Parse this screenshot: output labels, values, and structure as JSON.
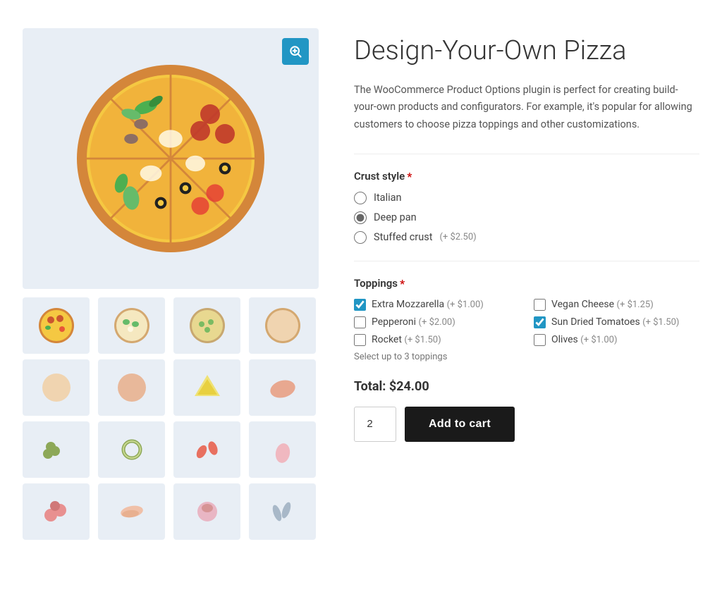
{
  "product": {
    "title": "Design-Your-Own Pizza",
    "description": "The WooCommerce Product Options plugin is perfect for creating build-your-own products and configurators. For example, it's popular for allowing customers to choose pizza toppings and other customizations.",
    "total_label": "Total: $24.00",
    "quantity": "2"
  },
  "zoom_icon": "🔍",
  "crust": {
    "label": "Crust style",
    "required": true,
    "options": [
      {
        "id": "italian",
        "label": "Italian",
        "price": "",
        "checked": false
      },
      {
        "id": "deep_pan",
        "label": "Deep pan",
        "price": "",
        "checked": true
      },
      {
        "id": "stuffed",
        "label": "Stuffed crust",
        "price": "(+ $2.50)",
        "checked": false
      }
    ]
  },
  "toppings": {
    "label": "Toppings",
    "required": true,
    "hint": "Select up to 3 toppings",
    "options": [
      {
        "id": "extra_mozz",
        "label": "Extra Mozzarella",
        "price": "(+ $1.00)",
        "checked": true,
        "col": 1
      },
      {
        "id": "pepperoni",
        "label": "Pepperoni",
        "price": "(+ $2.00)",
        "checked": false,
        "col": 1
      },
      {
        "id": "rocket",
        "label": "Rocket",
        "price": "(+ $1.50)",
        "checked": false,
        "col": 1
      },
      {
        "id": "vegan_cheese",
        "label": "Vegan Cheese",
        "price": "(+ $1.25)",
        "checked": false,
        "col": 2
      },
      {
        "id": "sun_dried",
        "label": "Sun Dried Tomatoes",
        "price": "(+ $1.50)",
        "checked": true,
        "col": 2
      },
      {
        "id": "olives",
        "label": "Olives",
        "price": "(+ $1.00)",
        "checked": false,
        "col": 2
      }
    ]
  },
  "buttons": {
    "add_to_cart": "Add to cart",
    "zoom_label": "Zoom"
  },
  "thumbnails": [
    {
      "color": "#e8a87c",
      "icon": "pizza"
    },
    {
      "color": "#d4e8c2",
      "icon": "pizza-white"
    },
    {
      "color": "#c5ddd4",
      "icon": "pizza-green"
    },
    {
      "color": "#f0d4b0",
      "icon": "plain"
    },
    {
      "color": "#f0d4b0",
      "icon": "plain2"
    },
    {
      "color": "#e8b89a",
      "icon": "dough"
    },
    {
      "color": "#f0e068",
      "icon": "cheese"
    },
    {
      "color": "#e8a890",
      "icon": "meat"
    },
    {
      "color": "#b8c890",
      "icon": "olives"
    },
    {
      "color": "#c8d890",
      "icon": "rings"
    },
    {
      "color": "#f0a080",
      "icon": "pepper"
    },
    {
      "color": "#f0b8b0",
      "icon": "shrimp"
    },
    {
      "color": "#e89090",
      "icon": "salami"
    },
    {
      "color": "#f0c0a8",
      "icon": "bacon"
    },
    {
      "color": "#e8a8b8",
      "icon": "flower"
    },
    {
      "color": "#b8c8d8",
      "icon": "fish"
    }
  ]
}
